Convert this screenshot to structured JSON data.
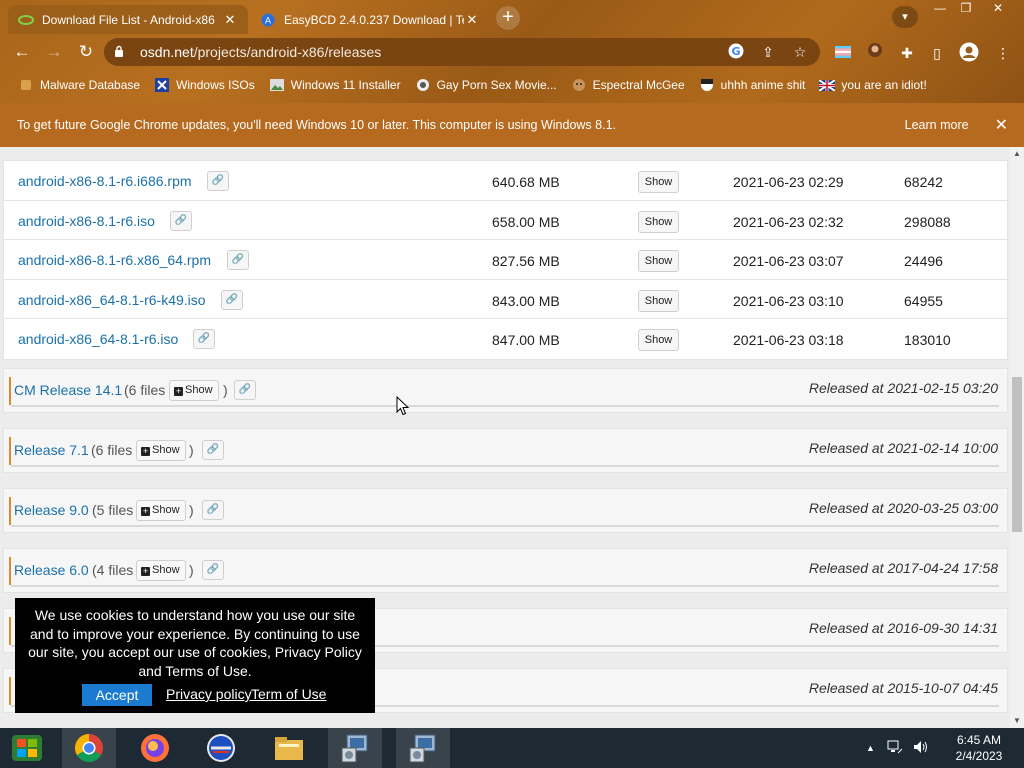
{
  "browser": {
    "tabs": [
      {
        "title": "Download File List - Android-x86",
        "icon": "osdn-favicon",
        "active": true
      },
      {
        "title": "EasyBCD 2.4.0.237 Download | Te",
        "icon": "techspot-favicon",
        "active": false
      }
    ],
    "url": {
      "domain": "osdn.net",
      "path": "/projects/android-x86/releases"
    },
    "bookmarks": [
      {
        "label": "Malware Database",
        "icon": "bookmark-icon"
      },
      {
        "label": "Windows ISOs",
        "icon": "x-logo-icon"
      },
      {
        "label": "Windows 11 Installer",
        "icon": "image-icon"
      },
      {
        "label": "Gay Porn Sex Movie...",
        "icon": "site-icon"
      },
      {
        "label": "Espectral McGee",
        "icon": "face-icon"
      },
      {
        "label": "uhhh anime shit",
        "icon": "anime-icon"
      },
      {
        "label": "you are an idiot!",
        "icon": "flag-icon"
      }
    ]
  },
  "infobar": {
    "message": "To get future Google Chrome updates, you'll need Windows 10 or later. This computer is using Windows 8.1.",
    "learn_more": "Learn more"
  },
  "files": [
    {
      "name": "android-x86-8.1-r6.i686.rpm",
      "size": "640.68 MB",
      "show": "Show",
      "date": "2021-06-23 02:29",
      "downloads": "68242"
    },
    {
      "name": "android-x86-8.1-r6.iso",
      "size": "658.00 MB",
      "show": "Show",
      "date": "2021-06-23 02:32",
      "downloads": "298088"
    },
    {
      "name": "android-x86-8.1-r6.x86_64.rpm",
      "size": "827.56 MB",
      "show": "Show",
      "date": "2021-06-23 03:07",
      "downloads": "24496"
    },
    {
      "name": "android-x86_64-8.1-r6-k49.iso",
      "size": "843.00 MB",
      "show": "Show",
      "date": "2021-06-23 03:10",
      "downloads": "64955"
    },
    {
      "name": "android-x86_64-8.1-r6.iso",
      "size": "847.00 MB",
      "show": "Show",
      "date": "2021-06-23 03:18",
      "downloads": "183010"
    }
  ],
  "releases": [
    {
      "name": "CM Release 14.1",
      "count": "(6 files",
      "show": "Show",
      "close_paren": ")",
      "released": "Released at 2021-02-15 03:20"
    },
    {
      "name": "Release 7.1",
      "count": "(6 files",
      "show": "Show",
      "close_paren": ")",
      "released": "Released at 2021-02-14 10:00"
    },
    {
      "name": "Release 9.0",
      "count": "(5 files",
      "show": "Show",
      "close_paren": ")",
      "released": "Released at 2020-03-25 03:00"
    },
    {
      "name": "Release 6.0",
      "count": "(4 files",
      "show": "Show",
      "close_paren": ")",
      "released": "Released at 2017-04-24 17:58"
    },
    {
      "name": "",
      "count": "",
      "show": "",
      "close_paren": "",
      "released": "Released at 2016-09-30 14:31"
    },
    {
      "name": "",
      "count": "",
      "show": "",
      "close_paren": "",
      "released": "Released at 2015-10-07 04:45"
    }
  ],
  "cookie_banner": {
    "text": "We use cookies to understand how you use our site and to improve your experience. By continuing to use our site, you accept our use of cookies, Privacy Policy and Terms of Use.",
    "accept": "Accept",
    "privacy": "Privacy policy",
    "terms": "Term of Use"
  },
  "taskbar": {
    "apps": [
      "windows-start-icon",
      "chrome-icon",
      "firefox-icon",
      "opera-icon",
      "file-explorer-icon",
      "installer-icon",
      "installer-icon"
    ],
    "time": "6:45 AM",
    "date": "2/4/2023"
  },
  "colors": {
    "link": "#1b71a8",
    "accent_bar": "#e08a2f",
    "accept_button": "#1b7bd1",
    "infobar": "#b66a1f"
  }
}
